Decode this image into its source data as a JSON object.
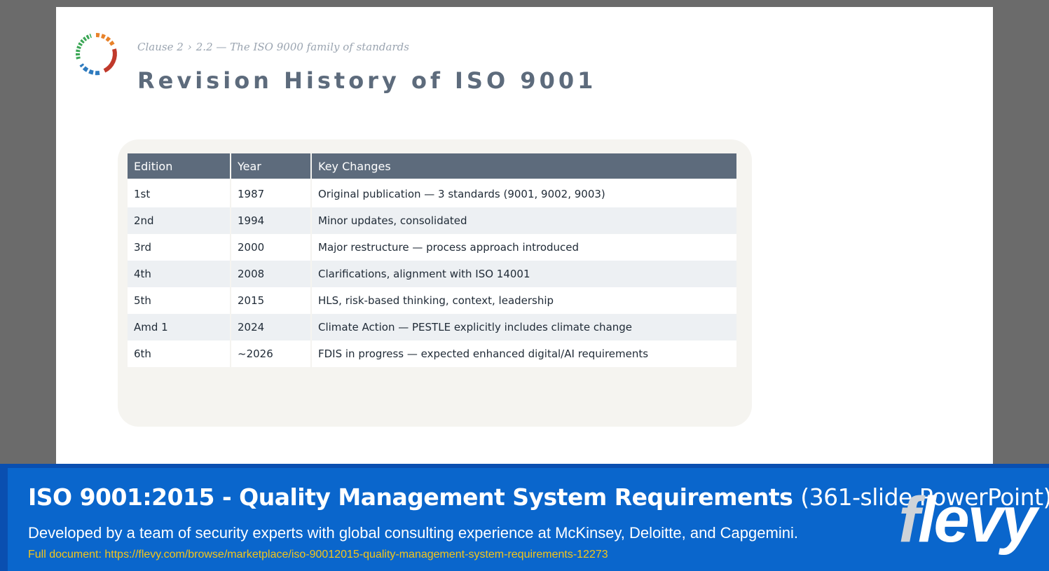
{
  "breadcrumb": {
    "clause": "Clause 2",
    "separator": "›",
    "section": "2.2 — The ISO 9000 family of standards"
  },
  "page_title": "Revision History of ISO 9001",
  "logo_colors": [
    "#e8822a",
    "#c0392b",
    "#2e7bbf",
    "#3aa655"
  ],
  "table": {
    "headers": [
      "Edition",
      "Year",
      "Key Changes"
    ],
    "header_color": "#5d6b7c",
    "rows": [
      [
        "1st",
        "1987",
        "Original publication — 3 standards (9001, 9002, 9003)"
      ],
      [
        "2nd",
        "1994",
        "Minor updates, consolidated"
      ],
      [
        "3rd",
        "2000",
        "Major restructure — process approach introduced"
      ],
      [
        "4th",
        "2008",
        "Clarifications, alignment with ISO 14001"
      ],
      [
        "5th",
        "2015",
        "HLS, risk-based thinking, context, leadership"
      ],
      [
        "Amd 1",
        "2024",
        "Climate Action — PESTLE explicitly includes climate change"
      ],
      [
        "6th",
        "~2026",
        "FDIS in progress — expected enhanced digital/AI requirements"
      ]
    ]
  },
  "banner": {
    "title_bold": "ISO 9001:2015 - Quality Management System Requirements",
    "title_light": "(361-slide PowerPoint)",
    "subtitle": "Developed by a team of security experts with global consulting experience at McKinsey, Deloitte, and Capgemini.",
    "link": "Full document: https://flevy.com/browse/marketplace/iso-90012015-quality-management-system-requirements-12273",
    "brand_first": "f",
    "brand_rest": "levy",
    "background_color": "#0a66cc",
    "link_color": "#f5c518"
  }
}
